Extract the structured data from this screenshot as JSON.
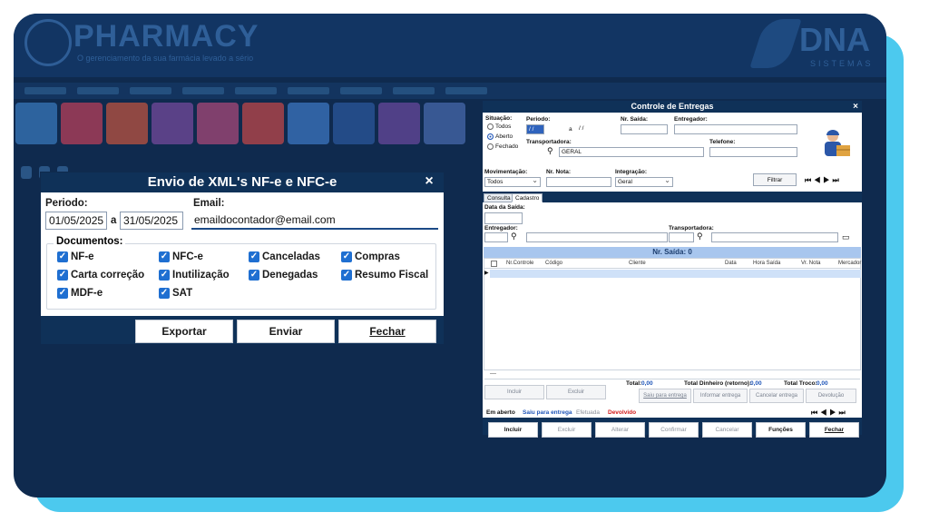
{
  "app": {
    "logo_text": "PHARMACY",
    "logo_subtitle": "O gerenciamento da sua farmácia levado a sério",
    "brand_text": "DNA",
    "brand_subtitle": "SISTEMAS"
  },
  "colors": {
    "navy": "#0f2a4e",
    "titlebar": "#0f3158",
    "accent": "#4cc9ee",
    "checkbox": "#1f6fd1",
    "status_blue": "#1f55b8",
    "status_red": "#d11b1b"
  },
  "xml_dialog": {
    "title": "Envio de XML's NF-e e NFC-e",
    "close_icon": "×",
    "periodo_label": "Periodo:",
    "date_from": "01/05/2025",
    "date_sep": "a",
    "date_to": "31/05/2025",
    "email_label": "Email:",
    "email_value": "emaildocontador@email.com",
    "documents_label": "Documentos:",
    "documents": [
      {
        "label": "NF-e",
        "checked": true
      },
      {
        "label": "NFC-e",
        "checked": true
      },
      {
        "label": "Canceladas",
        "checked": true
      },
      {
        "label": "Compras",
        "checked": true
      },
      {
        "label": "Carta correção",
        "checked": true
      },
      {
        "label": "Inutilização",
        "checked": true
      },
      {
        "label": "Denegadas",
        "checked": true
      },
      {
        "label": "Resumo Fiscal",
        "checked": true
      },
      {
        "label": "MDF-e",
        "checked": true
      },
      {
        "label": "SAT",
        "checked": true
      }
    ],
    "buttons": {
      "export": "Exportar",
      "send": "Enviar",
      "close": "Fechar"
    }
  },
  "entregas": {
    "title": "Controle de Entregas",
    "close_icon": "×",
    "situacao_label": "Situação:",
    "situacao_options": [
      {
        "label": "Todos",
        "selected": false
      },
      {
        "label": "Aberto",
        "selected": true
      },
      {
        "label": "Fechado",
        "selected": false
      }
    ],
    "periodo_label": "Periodo:",
    "periodo_from": "/ /",
    "periodo_sep": "a",
    "periodo_to": "/ /",
    "nr_saida_label": "Nr. Saída:",
    "entregador_label": "Entregador:",
    "transportadora_label": "Transportadora:",
    "transportadora_value": "GERAL",
    "telefone_label": "Telefone:",
    "movimentacao_label": "Movimentação:",
    "movimentacao_value": "Todos",
    "nr_nota_label": "Nr. Nota:",
    "integracao_label": "Integração:",
    "integracao_value": "Geral",
    "filtrar_label": "Filtrar",
    "tabs": [
      "Consulta",
      "Cadastro"
    ],
    "data_saida_label": "Data da Saída:",
    "entregador2_label": "Entregador:",
    "transportadora2_label": "Transportadora:",
    "grid_title": "Nr. Saída: 0",
    "columns": [
      "Nr.Controle",
      "Código",
      "Cliente",
      "Data",
      "Hora Saída",
      "Vr. Nota",
      "Mercador"
    ],
    "incluir_small": "Incluir",
    "excluir_small": "Excluir",
    "total_label": "Total:",
    "total_value": "0,00",
    "dinheiro_label": "Total Dinheiro (retorno):",
    "dinheiro_value": "0,00",
    "troco_label": "Total Troco:",
    "troco_value": "0,00",
    "action_buttons": [
      "Saiu para entrega",
      "Informar entrega",
      "Cancelar entrega",
      "Devolução"
    ],
    "legend": [
      {
        "label": "Em aberto",
        "color": "#111111"
      },
      {
        "label": "Saiu para entrega",
        "color": "#1f55b8"
      },
      {
        "label": "Efetuada",
        "color": "#8a8f99"
      },
      {
        "label": "Devolvido",
        "color": "#d11b1b"
      }
    ],
    "footer_buttons": [
      {
        "label": "Incluir",
        "enabled": true
      },
      {
        "label": "Excluir",
        "enabled": false
      },
      {
        "label": "Alterar",
        "enabled": false
      },
      {
        "label": "Confirmar",
        "enabled": false
      },
      {
        "label": "Cancelar",
        "enabled": false
      },
      {
        "label": "Funções",
        "enabled": true
      },
      {
        "label": "Fechar",
        "enabled": true
      }
    ]
  }
}
